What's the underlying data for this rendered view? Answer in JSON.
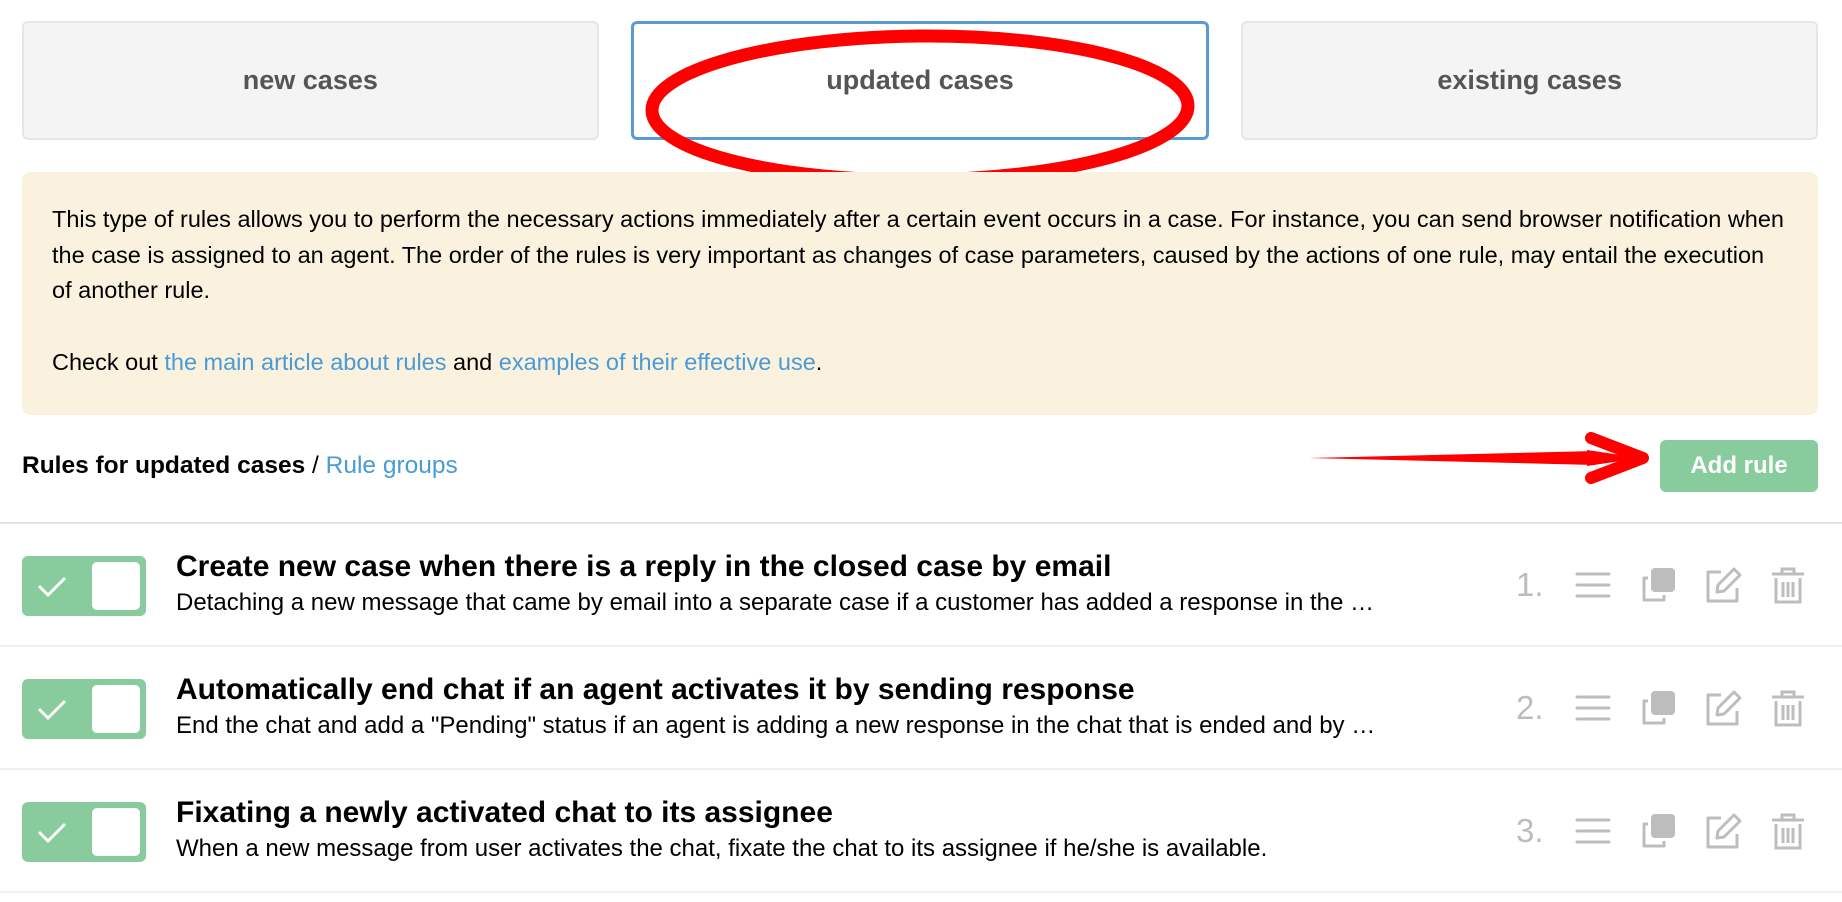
{
  "tabs": [
    {
      "label": "new cases",
      "active": false
    },
    {
      "label": "updated cases",
      "active": true
    },
    {
      "label": "existing cases",
      "active": false
    }
  ],
  "info": {
    "paragraph": "This type of rules allows you to perform the necessary actions immediately after a certain event occurs in a case. For instance, you can send browser notification when the case is assigned to an agent. The order of the rules is very important as changes of case parameters, caused by the actions of one rule, may entail the execution of another rule.",
    "check_prefix": "Check out ",
    "link_main_article": "the main article about rules",
    "check_and": " and ",
    "link_examples": "examples of their effective use",
    "check_suffix": "."
  },
  "list_header": {
    "title": "Rules for updated cases",
    "separator": " / ",
    "rule_groups_link": "Rule groups",
    "add_rule_label": "Add rule"
  },
  "colors": {
    "accent_green": "#88cc9e",
    "link_blue": "#4a9ad4",
    "active_tab_border": "#5b9bd5",
    "info_bg": "#faf2df",
    "annotation_red": "#ff0000"
  },
  "rules": [
    {
      "number": "1.",
      "enabled": true,
      "title": "Create new case when there is a reply in the closed case by email",
      "description": "Detaching a new message that came by email into a separate case if a customer has added a response in the …"
    },
    {
      "number": "2.",
      "enabled": true,
      "title": "Automatically end chat if an agent activates it by sending response",
      "description": "End the chat and add a \"Pending\" status if an agent is adding a new response in the chat that is ended and by …"
    },
    {
      "number": "3.",
      "enabled": true,
      "title": "Fixating a newly activated chat to its assignee",
      "description": "When a new message from user activates the chat, fixate the chat to its assignee if he/she is available."
    }
  ],
  "icons": {
    "toggle_check": "check-icon",
    "drag": "drag-handle-icon",
    "copy": "copy-icon",
    "edit": "edit-icon",
    "delete": "trash-icon"
  }
}
